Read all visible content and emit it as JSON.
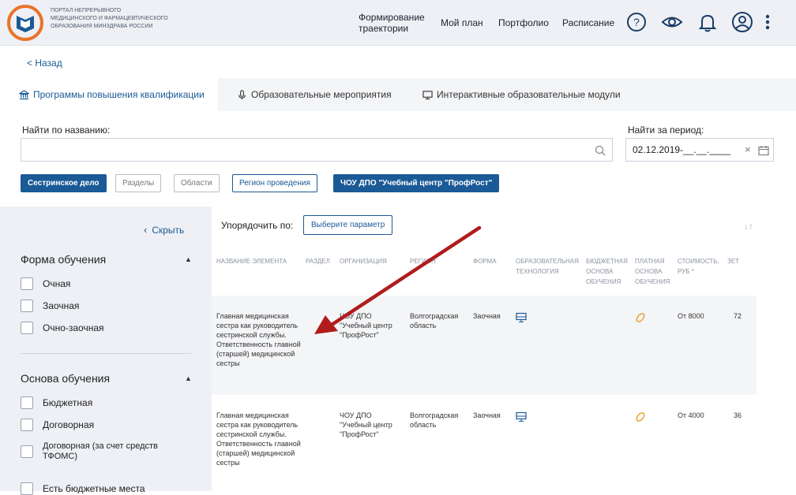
{
  "header": {
    "logo_text": "Портал непрерывного медицинского и фармацевтического образования Минздрава России",
    "nav": [
      {
        "label": "Формирование траектории"
      },
      {
        "label": "Мой план"
      },
      {
        "label": "Портфолио"
      },
      {
        "label": "Расписание"
      }
    ],
    "icons": [
      "help-icon",
      "eye-icon",
      "bell-icon",
      "user-icon",
      "more-vertical-icon"
    ]
  },
  "back_link": "< Назад",
  "tabs": [
    {
      "label": "Программы повышения квалификации",
      "icon": "bank-icon",
      "active": true
    },
    {
      "label": "Образовательные мероприятия",
      "icon": "microphone-icon",
      "active": false
    },
    {
      "label": "Интерактивные образовательные модули",
      "icon": "monitor-icon",
      "active": false
    }
  ],
  "search": {
    "label": "Найти по названию:",
    "value": "",
    "placeholder": ""
  },
  "period": {
    "label": "Найти за период:",
    "value": "02.12.2019-__.__.____"
  },
  "filters": [
    {
      "label": "Сестринское дело",
      "style": "primary"
    },
    {
      "label": "Разделы",
      "style": "default"
    },
    {
      "label": "Области",
      "style": "default"
    },
    {
      "label": "Регион проведения",
      "style": "outline"
    },
    {
      "label": "ЧОУ ДПО \"Учебный центр \"ПрофРост\"",
      "style": "primary"
    }
  ],
  "sidebar": {
    "hide_label": "Скрыть",
    "form_title": "Форма обучения",
    "form_options": [
      "Очная",
      "Заочная",
      "Очно-заочная"
    ],
    "basis_title": "Основа обучения",
    "basis_options": [
      "Бюджетная",
      "Договорная",
      "Договорная (за счет средств ТФОМС)"
    ],
    "extra_option": "Есть бюджетные места"
  },
  "results": {
    "sort_label": "Упорядочить по:",
    "sort_button": "Выберите параметр",
    "columns": [
      "Название элемента",
      "Раздел",
      "Организация",
      "Регион",
      "Форма",
      "Образовательная технология",
      "Бюджетная основа обучения",
      "Платная основа обучения",
      "Стоимость, руб *",
      "ЗЕТ"
    ],
    "rows": [
      {
        "name": "Главная медицинская сестра как руководитель сестринской службы. Ответственность главной (старшей) медицинской сестры",
        "section": "",
        "org": "ЧОУ ДПО \"Учебный центр \"ПрофРост\"",
        "region": "Волгоградская область",
        "form": "Заочная",
        "cost": "От 8000",
        "zet": "72"
      },
      {
        "name": "Главная медицинская сестра как руководитель сестринской службы. Ответственность главной (старшей) медицинской сестры",
        "section": "",
        "org": "ЧОУ ДПО \"Учебный центр \"ПрофРост\"",
        "region": "Волгоградская область",
        "form": "Заочная",
        "cost": "От 4000",
        "zet": "36"
      }
    ]
  },
  "colors": {
    "accent": "#1a5a96",
    "arrow": "#b01c1c",
    "paid_icon": "#e8a93a"
  }
}
